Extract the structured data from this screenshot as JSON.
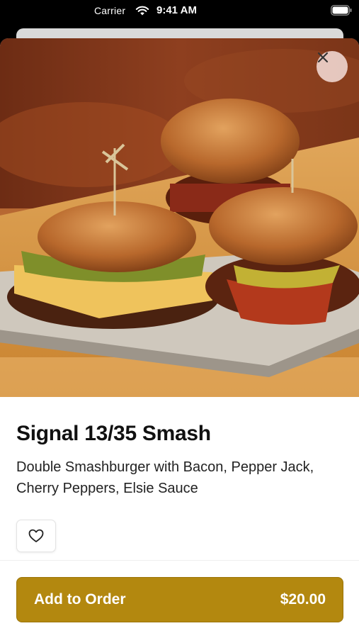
{
  "status_bar": {
    "carrier": "Carrier",
    "time": "9:41 AM"
  },
  "product": {
    "image_alt": "Three smashburgers with bacon and cheese on a metal tray",
    "title": "Signal 13/35 Smash",
    "description": "Double Smashburger with Bacon, Pepper Jack, Cherry Peppers, Elsie Sauce"
  },
  "actions": {
    "add_label": "Add to Order",
    "price": "$20.00"
  },
  "icons": {
    "close": "close-icon",
    "favorite": "heart-icon",
    "wifi": "wifi-icon",
    "battery": "battery-icon"
  },
  "colors": {
    "accent": "#b3880f",
    "close_bg": "#f0d6d0"
  }
}
